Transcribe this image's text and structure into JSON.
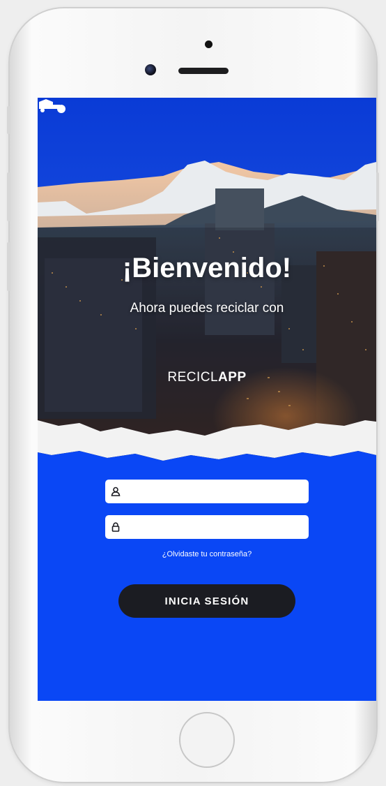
{
  "welcome": {
    "title": "¡Bienvenido!",
    "subtitle": "Ahora puedes reciclar con",
    "brand_regular": "RECICL",
    "brand_bold": "APP"
  },
  "login": {
    "username_placeholder": "",
    "password_placeholder": "",
    "forgot_label": "¿Olvidaste tu contraseña?",
    "submit_label": "INICIA SESIÓN"
  },
  "icons": {
    "username": "user-icon",
    "password": "lock-icon",
    "brand": "recycling-truck-icon"
  },
  "colors": {
    "screen_background": "#0a47f5",
    "button_background": "#1b1c22",
    "text": "#ffffff"
  }
}
